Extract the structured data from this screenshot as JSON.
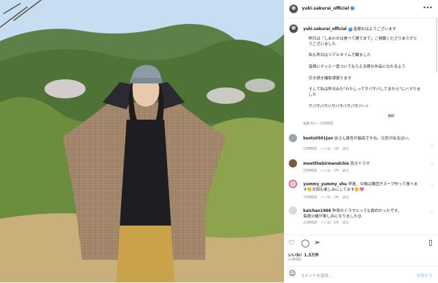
{
  "post": {
    "username": "yuki.sakurai_official",
    "more_icon": "more-horizontal-icon",
    "caption_username": "yuki.sakurai_official",
    "caption_lines": [
      "皆様おはようございます",
      "昨日は「しあわせは食べて寝てまて」ご視聴くださりありがと",
      "うございました",
      "",
      "私も昨日はリアルタイムで観ました",
      "",
      "皆様にホッと一息ついてもらえる様な作品になれるよう",
      "",
      "引き続き撮影頑張ります",
      "",
      "そして私は昨日みた\"わたしってサバサバしてるから\"にハマりま",
      "した",
      "",
      "サバサバサバサバサバサバサバ〜♪"
    ],
    "translate": "翻訳",
    "edited": "編集済み・23時間前",
    "likes": "いいね！1.3万件",
    "timestamp": "23時間前",
    "comment_placeholder": "コメントを追加...",
    "post_button": "投稿する"
  },
  "comments": [
    {
      "user": "kents0501jun",
      "text": "谷さん景色が最高ですね。元気が出るはい。",
      "text2": "",
      "time": "23時間前",
      "likes": "いいね！2件",
      "reply": "返信",
      "avatar_color": "#9aa4b0"
    },
    {
      "user": "moetthebirmandchie",
      "text": "良きドラマ",
      "text2": "",
      "time": "23時間前",
      "likes": "いいね！2件",
      "reply": "返信",
      "avatar_color": "#7a5a3c"
    },
    {
      "user": "yummy_yummy_shu",
      "text": "早速、今晩は鶏団子スープ作って食べま",
      "text2": "す🤭次回も楽しみにしてます🌼💖",
      "time": "23時間前",
      "likes": "いいね！2件",
      "reply": "返信",
      "avatar_color": "#e7c7cf"
    },
    {
      "user": "kaichan1966",
      "text": "昨夜のドラマとっても面白かったです。",
      "text2": "毎週火曜が楽しみになりました😊",
      "time": "22時間前",
      "likes": "いいね！2件",
      "reply": "返信",
      "avatar_color": "#e0d9cf"
    }
  ],
  "icons": {
    "like": "heart-icon",
    "comment": "comment-icon",
    "share": "send-icon",
    "save": "bookmark-icon",
    "emoji": "smiley-icon"
  },
  "colors": {
    "verified": "#3897f0",
    "meta": "#8e8e8e",
    "text": "#262626"
  }
}
